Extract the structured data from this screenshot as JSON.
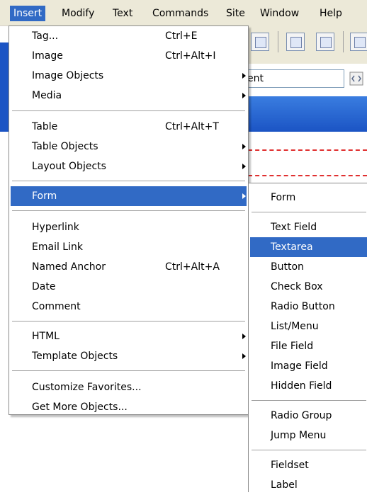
{
  "menubar": {
    "items": [
      "Insert",
      "Modify",
      "Text",
      "Commands",
      "Site",
      "Window",
      "Help"
    ],
    "active": "Insert"
  },
  "background": {
    "input_value": "ent"
  },
  "insert_menu": {
    "items": [
      {
        "label": "Tag...",
        "shortcut": "Ctrl+E"
      },
      {
        "label": "Image",
        "shortcut": "Ctrl+Alt+I"
      },
      {
        "label": "Image Objects",
        "submenu": true
      },
      {
        "label": "Media",
        "submenu": true
      },
      {
        "label": "Table",
        "shortcut": "Ctrl+Alt+T"
      },
      {
        "label": "Table Objects",
        "submenu": true
      },
      {
        "label": "Layout Objects",
        "submenu": true
      },
      {
        "label": "Form",
        "submenu": true,
        "highlighted": true
      },
      {
        "label": "Hyperlink"
      },
      {
        "label": "Email Link"
      },
      {
        "label": "Named Anchor",
        "shortcut": "Ctrl+Alt+A"
      },
      {
        "label": "Date"
      },
      {
        "label": "Comment"
      },
      {
        "label": "HTML",
        "submenu": true
      },
      {
        "label": "Template Objects",
        "submenu": true
      },
      {
        "label": "Customize Favorites..."
      },
      {
        "label": "Get More Objects..."
      }
    ]
  },
  "form_submenu": {
    "items": [
      {
        "label": "Form"
      },
      {
        "label": "Text Field"
      },
      {
        "label": "Textarea",
        "highlighted": true
      },
      {
        "label": "Button"
      },
      {
        "label": "Check Box"
      },
      {
        "label": "Radio Button"
      },
      {
        "label": "List/Menu"
      },
      {
        "label": "File Field"
      },
      {
        "label": "Image Field"
      },
      {
        "label": "Hidden Field"
      },
      {
        "label": "Radio Group"
      },
      {
        "label": "Jump Menu"
      },
      {
        "label": "Fieldset"
      },
      {
        "label": "Label"
      }
    ]
  },
  "colors": {
    "highlight": "#316ac5",
    "menubar_bg": "#ece9d8",
    "dashed_guide": "#e03030"
  }
}
